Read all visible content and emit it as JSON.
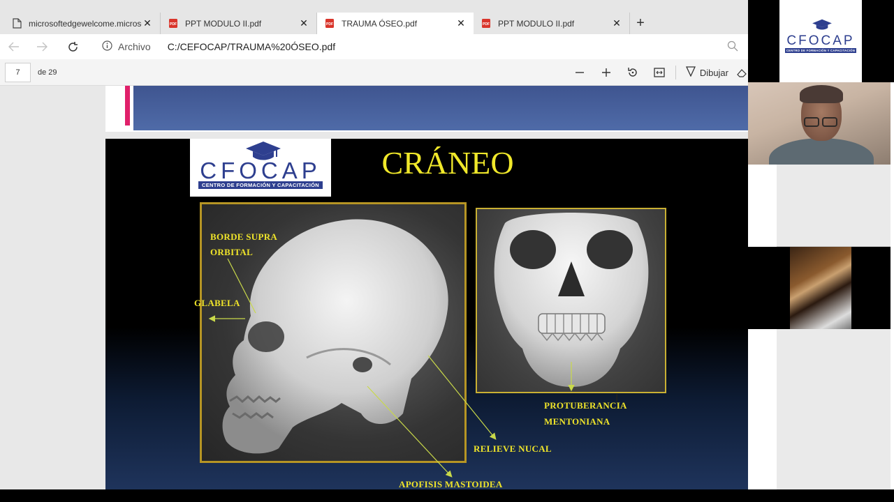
{
  "tabs": [
    {
      "label": "microsoftedgewelcome.microsoft.com",
      "type": "page",
      "active": false
    },
    {
      "label": "PPT MODULO II.pdf",
      "type": "pdf",
      "active": false
    },
    {
      "label": "TRAUMA ÓSEO.pdf",
      "type": "pdf",
      "active": true
    },
    {
      "label": "PPT MODULO II.pdf",
      "type": "pdf",
      "active": false
    }
  ],
  "address": {
    "info_label": "Archivo",
    "url": "C:/CEFOCAP/TRAUMA%20ÓSEO.pdf"
  },
  "pdf_toolbar": {
    "page_current": "7",
    "page_total": "de 29",
    "draw_label": "Dibujar"
  },
  "slide": {
    "title": "CRÁNEO",
    "logo_word": "CFOCAP",
    "logo_sub": "CENTRO DE FORMACIÓN Y CAPACITACIÓN",
    "labels": {
      "supraorbital_1": "BORDE SUPRA",
      "supraorbital_2": "ORBITAL",
      "glabela": "GLABELA",
      "protuberancia_1": "PROTUBERANCIA",
      "protuberancia_2": "MENTONIANA",
      "relieve": "RELIEVE  NUCAL",
      "apofisis": "APOFISIS  MASTOIDEA"
    }
  },
  "side_logo": {
    "word": "CFOCAP",
    "sub": "CENTRO DE FORMACIÓN Y CAPACITACIÓN"
  },
  "colors": {
    "accent_yellow": "#f0e82a",
    "logo_blue": "#2e3f8f",
    "pdf_red": "#d9352b",
    "slide_pink_bar": "#e0206a"
  }
}
